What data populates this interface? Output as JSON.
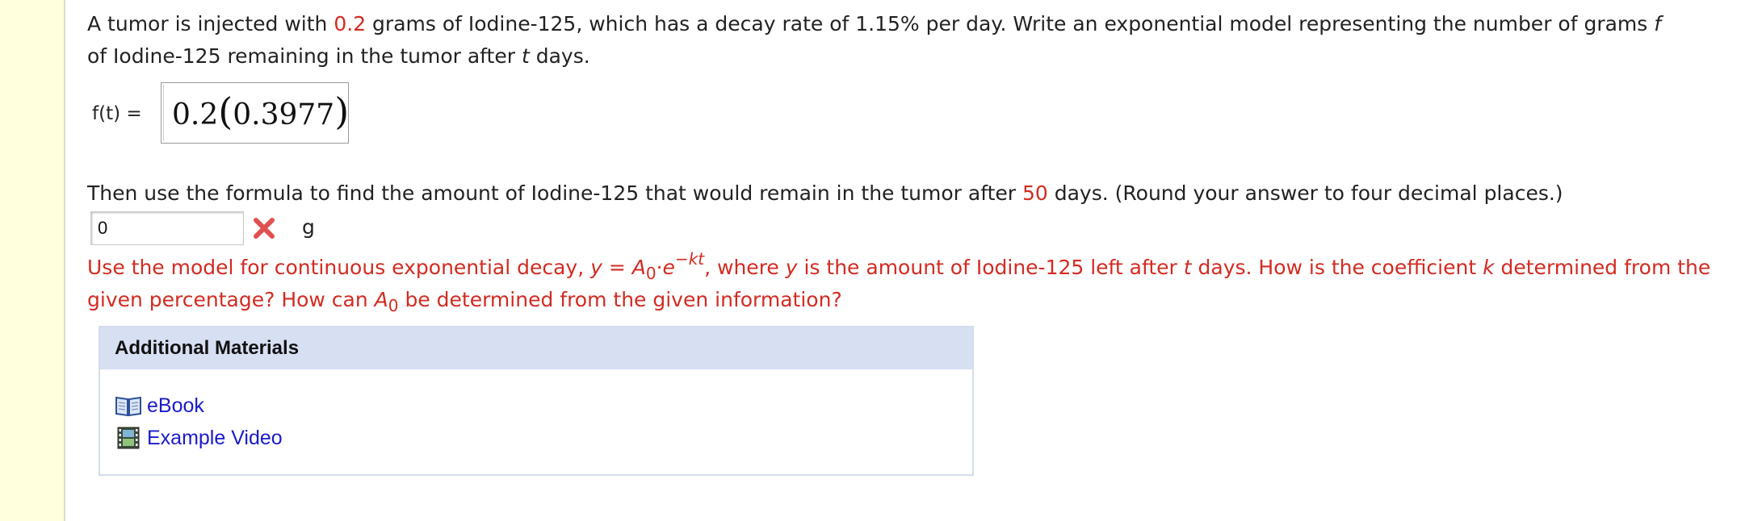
{
  "question": {
    "part1_a": "A tumor is injected with ",
    "dose": "0.2",
    "part1_b": " grams of Iodine-125, which has a decay rate of 1.15% per day. Write an exponential model representing the number of grams ",
    "var_f": "f",
    "part1_c": " of Iodine-125 remaining in the tumor after ",
    "var_t": "t",
    "part1_d": " days."
  },
  "model": {
    "label": "f(t) =",
    "coef": "0.2",
    "open_paren": "(",
    "base": "0.3977",
    "close_paren": ")"
  },
  "question2": {
    "part_a": "Then use the formula to find the amount of Iodine-125 that would remain in the tumor after ",
    "days": "50",
    "part_b": " days. (Round your answer to four decimal places.)"
  },
  "answer": {
    "value": "0",
    "unit": "g",
    "status_icon": "incorrect-x-icon"
  },
  "hint": {
    "a": "Use the model for continuous exponential decay,  ",
    "y": "y",
    "eq": " = ",
    "A": "A",
    "sub0": "0",
    "dot": "·",
    "e": "e",
    "exp": "−kt",
    "b": ",  where ",
    "y2": "y",
    "c": " is the amount of Iodine-125 left after ",
    "t": "t",
    "d": " days. How is the coefficient ",
    "k": "k",
    "e2": " determined from the given percentage? How can  ",
    "A2": "A",
    "sub02": "0",
    "f": "  be determined from the given information?"
  },
  "materials": {
    "title": "Additional Materials",
    "links": [
      {
        "label": "eBook",
        "icon": "book-icon"
      },
      {
        "label": "Example Video",
        "icon": "film-icon"
      }
    ]
  },
  "colors": {
    "highlight_red": "#d32b22",
    "link_blue": "#1a1acc",
    "panel_header": "#d7dff3",
    "left_strip": "#ffffdd"
  }
}
